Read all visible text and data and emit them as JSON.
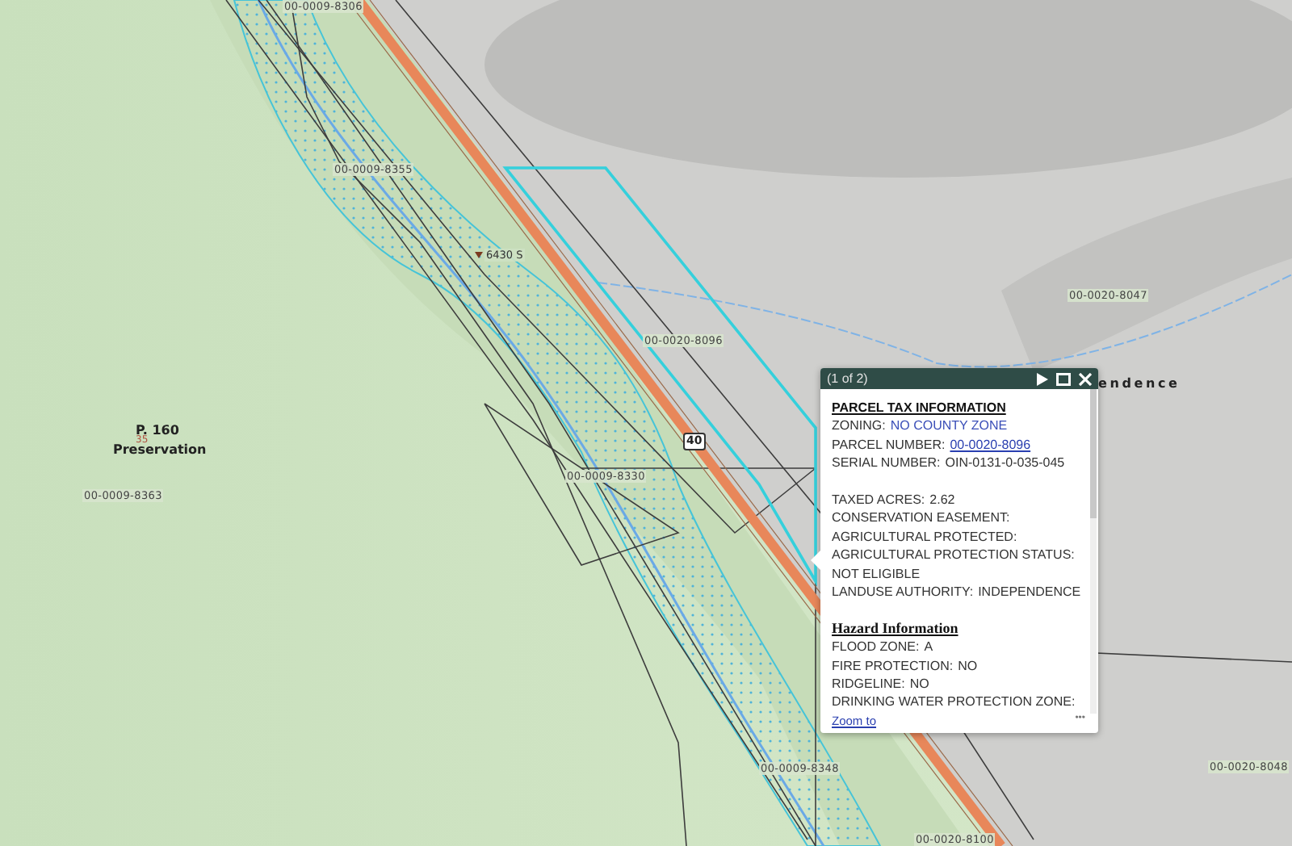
{
  "map": {
    "labels": [
      {
        "text": "00-0009-8306",
        "kind": "parcel"
      },
      {
        "text": "00-0009-8355",
        "kind": "parcel"
      },
      {
        "text": "6430 S",
        "kind": "address"
      },
      {
        "text": "00-0020-8096",
        "kind": "parcel"
      },
      {
        "text": "00-0020-8047",
        "kind": "parcel"
      },
      {
        "text": "00-0009-8363",
        "kind": "parcel"
      },
      {
        "text": "00-0009-8330",
        "kind": "parcel"
      },
      {
        "text": "00-0009-8348",
        "kind": "parcel"
      },
      {
        "text": "00-0020-8048",
        "kind": "parcel"
      },
      {
        "text": "00-0020-8100",
        "kind": "parcel"
      },
      {
        "text": "endence",
        "kind": "place"
      }
    ],
    "zone_label": {
      "title": "P. 160",
      "number": "35",
      "name": "Preservation"
    },
    "road_shield": "40"
  },
  "popup": {
    "counter": "(1 of 2)",
    "sections": [
      {
        "heading": "PARCEL TAX INFORMATION",
        "groups": [
          [
            {
              "label": "ZONING:",
              "value": "NO COUNTY ZONE",
              "kind": "blue"
            },
            {
              "label": "PARCEL NUMBER:",
              "value": "00-0020-8096",
              "kind": "link"
            },
            {
              "label": "SERIAL NUMBER:",
              "value": "OIN-0131-0-035-045",
              "kind": "plain"
            }
          ],
          [
            {
              "label": "TAXED ACRES:",
              "value": "2.62",
              "kind": "plain"
            },
            {
              "label": "CONSERVATION EASEMENT:"
            },
            {
              "label": "AGRICULTURAL PROTECTED:"
            },
            {
              "label": "AGRICULTURAL PROTECTION STATUS:",
              "value": "NOT ELIGIBLE",
              "kind": "block"
            },
            {
              "label": "LANDUSE AUTHORITY:",
              "value": "INDEPENDENCE",
              "kind": "plain"
            }
          ]
        ]
      },
      {
        "heading": "Hazard Information",
        "groups": [
          [
            {
              "label": "FLOOD ZONE:",
              "value": "A",
              "kind": "plain"
            },
            {
              "label": "FIRE PROTECTION:",
              "value": "NO",
              "kind": "plain"
            },
            {
              "label": "RIDGELINE:",
              "value": "NO",
              "kind": "plain"
            },
            {
              "label": "DRINKING WATER PROTECTION ZONE:"
            }
          ]
        ]
      }
    ],
    "footer_link": "Zoom to",
    "more": "•••"
  }
}
